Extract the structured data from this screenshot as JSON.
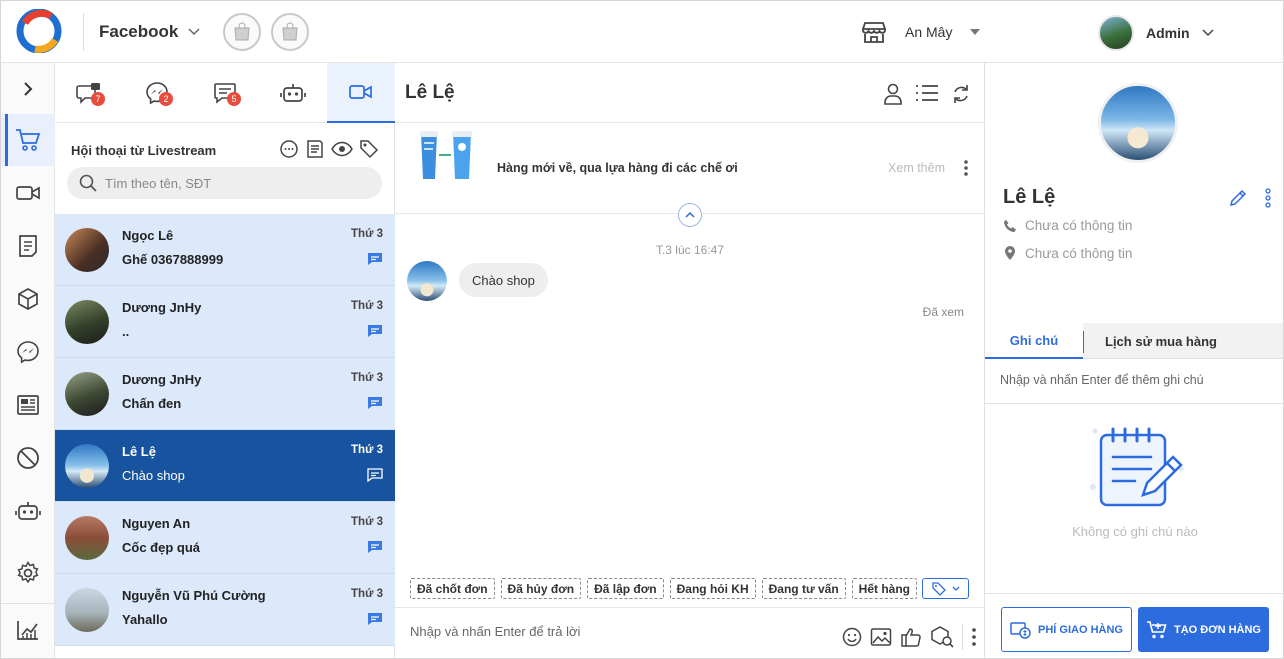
{
  "topbar": {
    "page_name": "Facebook",
    "store_name": "An Mây",
    "user_name": "Admin"
  },
  "left_nav": [
    "expand-icon",
    "cart-icon",
    "video-icon",
    "document-icon",
    "box-icon",
    "messenger-icon",
    "newspaper-icon",
    "ban-icon",
    "bot-icon",
    "gear-icon",
    "chart-icon"
  ],
  "tabs": [
    {
      "icon": "comment-lock-icon",
      "badge": "7"
    },
    {
      "icon": "messenger-icon",
      "badge": "2"
    },
    {
      "icon": "message-icon",
      "badge": "5"
    },
    {
      "icon": "bot-icon",
      "badge": ""
    },
    {
      "icon": "video-icon",
      "badge": ""
    }
  ],
  "list": {
    "title": "Hội thoại từ Livestream",
    "search_placeholder": "Tìm theo tên, SĐT",
    "conversations": [
      {
        "name": "Ngọc Lê",
        "message": "Ghế 0367888999",
        "time": "Thứ 3"
      },
      {
        "name": "Dương JnHy",
        "message": "..",
        "time": "Thứ 3"
      },
      {
        "name": "Dương JnHy",
        "message": "Chấn đen",
        "time": "Thứ 3"
      },
      {
        "name": "Lê Lệ",
        "message": "Chào shop",
        "time": "Thứ 3"
      },
      {
        "name": "Nguyen An",
        "message": "Cốc đẹp quá",
        "time": "Thứ 3"
      },
      {
        "name": "Nguyễn Vũ Phú Cường",
        "message": "Yahallo",
        "time": "Thứ 3"
      }
    ]
  },
  "chat": {
    "title": "Lê Lệ",
    "post_text": "Hàng mới về, qua lựa hàng đi các chế ơi",
    "see_more": "Xem thêm",
    "timestamp": "T.3 lúc 16:47",
    "bubble": "Chào shop",
    "seen": "Đã xem",
    "quick_tags": [
      "Đã chốt đơn",
      "Đã hủy đơn",
      "Đã lập đơn",
      "Đang hỏi KH",
      "Đang tư vấn",
      "Hết hàng"
    ],
    "composer_placeholder": "Nhập và nhấn Enter để trả lời"
  },
  "profile": {
    "name": "Lê Lệ",
    "phone": "Chưa có thông tin",
    "address": "Chưa có thông tin",
    "tab_notes": "Ghi chú",
    "tab_history": "Lịch sử mua hàng",
    "note_placeholder": "Nhập và nhấn Enter để thêm ghi chú",
    "empty_notes": "Không có ghi chú nào",
    "ship_fee_button": "PHÍ GIAO HÀNG",
    "create_order_button": "TẠO ĐƠN HÀNG"
  },
  "colors": {
    "accent": "#2d6cdf",
    "selected_row": "#17539e",
    "row_bg": "#dbe9fb",
    "badge": "#e84c3d"
  }
}
